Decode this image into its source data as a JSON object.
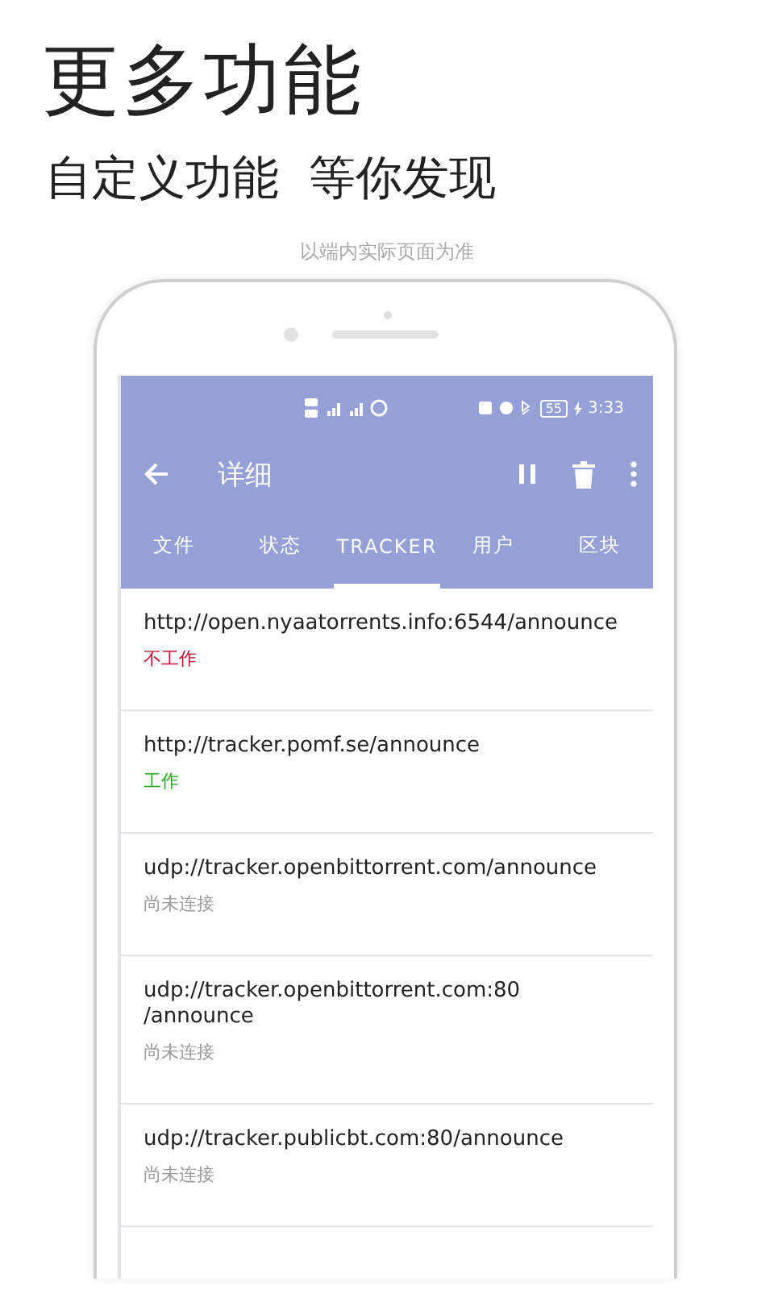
{
  "headline": "更多功能",
  "subtitle": "自定义功能  等你发现",
  "caption": "以端内实际页面为准",
  "phone": {
    "status_bar": {
      "battery": "55",
      "time": "3:33"
    },
    "toolbar": {
      "title": "详细"
    },
    "tabs": [
      {
        "label": "文件",
        "selected": false
      },
      {
        "label": "状态",
        "selected": false
      },
      {
        "label": "TRACKER",
        "selected": true
      },
      {
        "label": "用户",
        "selected": false
      },
      {
        "label": "区块",
        "selected": false
      }
    ],
    "trackers": [
      {
        "url": "http://open.nyaatorrents.info:6544/announce",
        "status": "不工作",
        "kind": "error"
      },
      {
        "url": "http://tracker.pomf.se/announce",
        "status": "工作",
        "kind": "working"
      },
      {
        "url": "udp://tracker.openbittorrent.com/announce",
        "status": "尚未连接",
        "kind": "pending"
      },
      {
        "url": "udp://tracker.openbittorrent.com:80\n/announce",
        "status": "尚未连接",
        "kind": "pending"
      },
      {
        "url": "udp://tracker.publicbt.com:80/announce",
        "status": "尚未连接",
        "kind": "pending"
      }
    ]
  }
}
